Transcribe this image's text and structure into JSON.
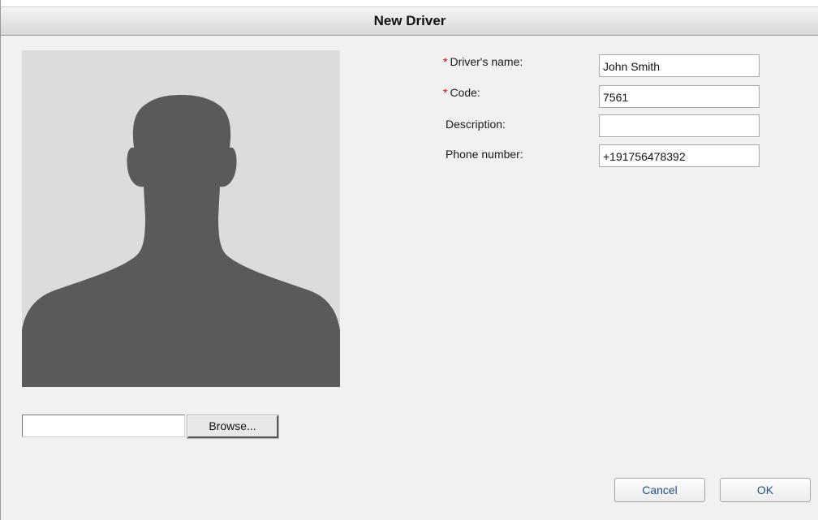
{
  "dialog": {
    "title": "New Driver"
  },
  "photo": {
    "icon": "person-silhouette"
  },
  "file_upload": {
    "value": "",
    "browse_label": "Browse..."
  },
  "form": {
    "required_marker": "*",
    "driver_name": {
      "label": "Driver's name:",
      "value": "John Smith",
      "required": true
    },
    "code": {
      "label": "Code:",
      "value": "7561",
      "required": true
    },
    "description": {
      "label": "Description:",
      "value": "",
      "required": false
    },
    "phone": {
      "label": "Phone number:",
      "value": "+191756478392",
      "required": false
    }
  },
  "buttons": {
    "cancel": "Cancel",
    "ok": "OK"
  },
  "colors": {
    "required": "#d40000",
    "button_text": "#1f4f86",
    "silhouette": "#5a5a5a",
    "photo_bg": "#dcdcdc"
  }
}
